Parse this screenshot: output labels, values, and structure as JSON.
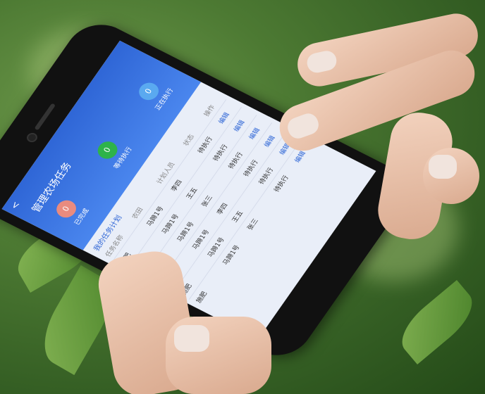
{
  "app": {
    "title": "管理农场任务",
    "back_label": "<"
  },
  "stats": [
    {
      "label": "已完成",
      "value": "0",
      "color": "#e98b7f"
    },
    {
      "label": "等待执行",
      "value": "0",
      "color": "#2eb34a"
    },
    {
      "label": "正在执行",
      "value": "0",
      "color": "#5aa9f0"
    }
  ],
  "section": {
    "title": "我的任务计划"
  },
  "table": {
    "headers": [
      "任务名称",
      "农田",
      "计划人员",
      "状态",
      "操作"
    ],
    "rows": [
      [
        "施肥",
        "马蹄1号",
        "李四",
        "待执行",
        "编辑"
      ],
      [
        "施肥",
        "马蹄1号",
        "王五",
        "待执行",
        "编辑"
      ],
      [
        "施肥",
        "马蹄1号",
        "张三",
        "待执行",
        "编辑"
      ],
      [
        "施肥",
        "马蹄1号",
        "李四",
        "待执行",
        "编辑"
      ],
      [
        "施肥",
        "马蹄1号",
        "王五",
        "待执行",
        "编辑"
      ],
      [
        "施肥",
        "马蹄1号",
        "张三",
        "待执行",
        "编辑"
      ]
    ]
  }
}
